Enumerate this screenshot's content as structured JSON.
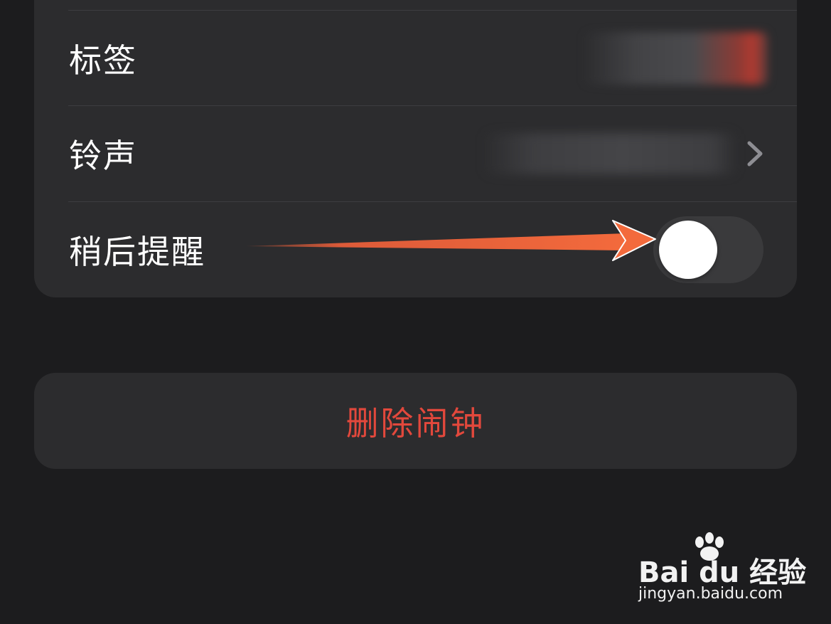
{
  "settings": {
    "rows": [
      {
        "label": "标签",
        "value_blurred": true
      },
      {
        "label": "铃声",
        "value_blurred": true
      },
      {
        "label": "稍后提醒",
        "toggle_on": false
      }
    ]
  },
  "actions": {
    "delete_label": "删除闹钟"
  },
  "colors": {
    "background": "#1c1c1e",
    "card": "#2c2c2e",
    "destructive": "#e2483c",
    "annotation_arrow": "#f0603a"
  },
  "icons": {
    "chevron": "chevron-right-icon",
    "annotation": "arrow-annotation-icon",
    "watermark_logo": "paw-logo"
  },
  "watermark": {
    "brand": "Bai du 经验",
    "url": "jingyan.baidu.com"
  }
}
